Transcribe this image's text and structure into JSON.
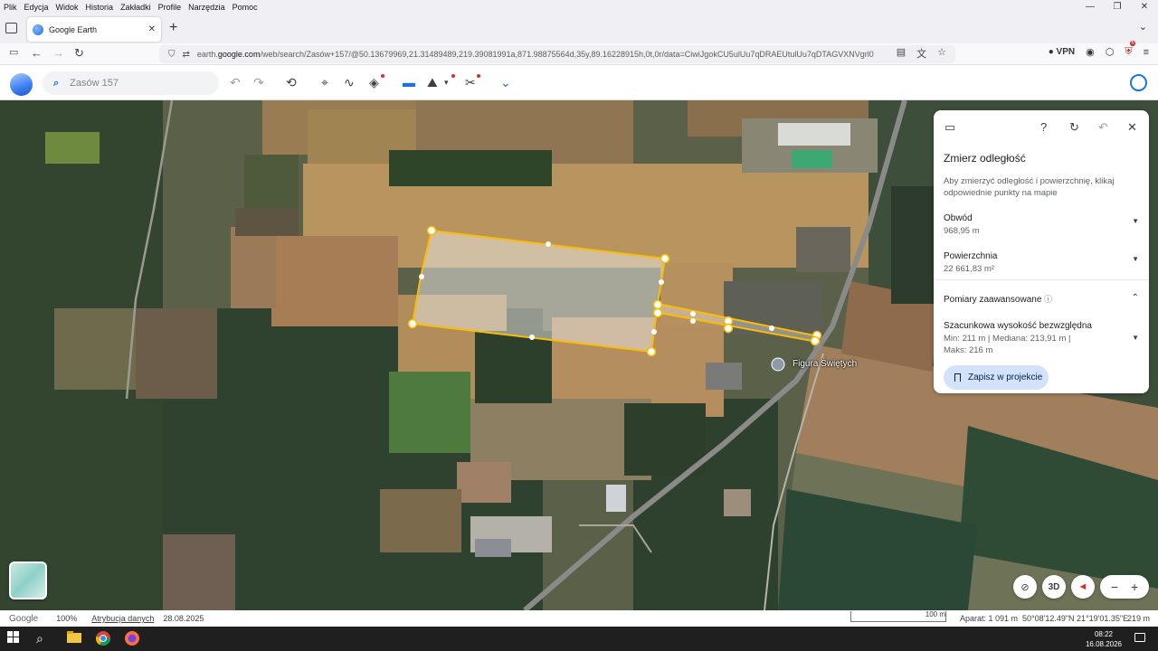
{
  "browser": {
    "menu": [
      "Plik",
      "Edycja",
      "Widok",
      "Historia",
      "Zakładki",
      "Profile",
      "Narzędzia",
      "Pomoc"
    ],
    "tab_title": "Google Earth",
    "url_prefix": "earth.",
    "url_domain": "google.com",
    "url_rest": "/web/search/Zasów+157/@50.13679969,21.31489489,219.39081991a,871.98875564d,35y,89.16228915h,0t,0r/data=CiwiJgokCU5ulUu7qDRAEUtulUu7qDTAGVXNVgrl0",
    "vpn_label": "VPN",
    "ext_badge": "6"
  },
  "earth_toolbar": {
    "search_placeholder": "Zasów 157"
  },
  "panel": {
    "title": "Zmierz odległość",
    "description": "Aby zmierzyć odległość i powierzchnię, klikaj odpowiednie punkty na mapie",
    "perimeter_label": "Obwód",
    "perimeter_value": "968,95 m",
    "area_label": "Powierzchnia",
    "area_value": "22 661,83 m²",
    "advanced_label": "Pomiary zaawansowane",
    "altitude_label": "Szacunkowa wysokość bezwzględna",
    "altitude_line1": "Min: 211 m | Mediana: 213,91 m |",
    "altitude_line2": "Maks: 216 m",
    "save_button": "Zapisz w projekcie"
  },
  "map": {
    "place_label": "Figura Świętych",
    "measure_color": "#fbbc04"
  },
  "controls": {
    "three_d_label": "3D"
  },
  "status": {
    "brand": "Google",
    "zoom": "100%",
    "attribution": "Atrybucja danych",
    "date": "28.08.2025",
    "scale_label": "100 m",
    "camera": "Aparat: 1 091 m",
    "coords": "50°08'12.49\"N 21°19'01.35\"E",
    "elevation": "219 m"
  },
  "taskbar": {
    "time": "08:22",
    "date": "16.08.2026"
  }
}
